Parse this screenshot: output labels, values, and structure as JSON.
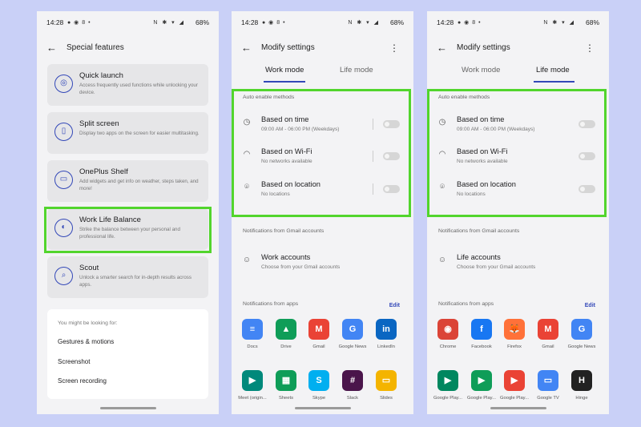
{
  "status": {
    "time": "14:28",
    "battery": "68%"
  },
  "phone1": {
    "title": "Special features",
    "features": [
      {
        "title": "Quick launch",
        "desc": "Access frequently used functions while unlocking your device.",
        "icon": "quick-launch-icon"
      },
      {
        "title": "Split screen",
        "desc": "Display two apps on the screen for easier multitasking.",
        "icon": "split-screen-icon"
      },
      {
        "title": "OnePlus Shelf",
        "desc": "Add widgets and get info on weather, steps taken, and more!",
        "icon": "shelf-icon"
      },
      {
        "title": "Work Life Balance",
        "desc": "Strike the balance between your personal and professional life.",
        "icon": "balance-icon"
      },
      {
        "title": "Scout",
        "desc": "Unlock a smarter search for in-depth results across apps.",
        "icon": "search-icon"
      }
    ],
    "suggest_header": "You might be looking for:",
    "suggestions": [
      "Gestures & motions",
      "Screenshot",
      "Screen recording"
    ]
  },
  "modify": {
    "title": "Modify settings",
    "tabs": [
      "Work mode",
      "Life mode"
    ],
    "auto_header": "Auto enable methods",
    "methods": [
      {
        "title": "Based on time",
        "sub": "09:00 AM - 06:00 PM (Weekdays)",
        "icon": "clock-icon",
        "enabled": false
      },
      {
        "title": "Based on Wi-Fi",
        "sub": "No networks available",
        "icon": "wifi-icon",
        "enabled": false
      },
      {
        "title": "Based on location",
        "sub": "No locations",
        "icon": "location-icon",
        "enabled": false
      }
    ],
    "gmail_header": "Notifications from Gmail accounts",
    "apps_header": "Notifications from apps",
    "edit_label": "Edit"
  },
  "work": {
    "account_title": "Work accounts",
    "account_sub": "Choose from your Gmail accounts",
    "apps": [
      {
        "label": "Docs",
        "color": "#4285f4",
        "glyph": "≡"
      },
      {
        "label": "Drive",
        "color": "#0f9d58",
        "glyph": "▲"
      },
      {
        "label": "Gmail",
        "color": "#ea4335",
        "glyph": "M"
      },
      {
        "label": "Google News",
        "color": "#4285f4",
        "glyph": "G"
      },
      {
        "label": "LinkedIn",
        "color": "#0a66c2",
        "glyph": "in"
      },
      {
        "label": "Meet (origin...",
        "color": "#00897b",
        "glyph": "▶"
      },
      {
        "label": "Sheets",
        "color": "#0f9d58",
        "glyph": "▦"
      },
      {
        "label": "Skype",
        "color": "#00aff0",
        "glyph": "S"
      },
      {
        "label": "Slack",
        "color": "#4a154b",
        "glyph": "#"
      },
      {
        "label": "Slides",
        "color": "#f4b400",
        "glyph": "▭"
      }
    ]
  },
  "life": {
    "account_title": "Life accounts",
    "account_sub": "Choose from your Gmail accounts",
    "apps": [
      {
        "label": "Chrome",
        "color": "#db4437",
        "glyph": "◉"
      },
      {
        "label": "Facebook",
        "color": "#1877f2",
        "glyph": "f"
      },
      {
        "label": "Firefox",
        "color": "#ff7139",
        "glyph": "🦊"
      },
      {
        "label": "Gmail",
        "color": "#ea4335",
        "glyph": "M"
      },
      {
        "label": "Google News",
        "color": "#4285f4",
        "glyph": "G"
      },
      {
        "label": "Google Play...",
        "color": "#01875f",
        "glyph": "▶"
      },
      {
        "label": "Google Play...",
        "color": "#0f9d58",
        "glyph": "▶"
      },
      {
        "label": "Google Play...",
        "color": "#ea4335",
        "glyph": "▶"
      },
      {
        "label": "Google TV",
        "color": "#4285f4",
        "glyph": "▭"
      },
      {
        "label": "Hinge",
        "color": "#222222",
        "glyph": "H"
      }
    ]
  },
  "colors": {
    "accent": "#3348b8",
    "highlight": "#52d52d",
    "background": "#c9d0f7"
  }
}
